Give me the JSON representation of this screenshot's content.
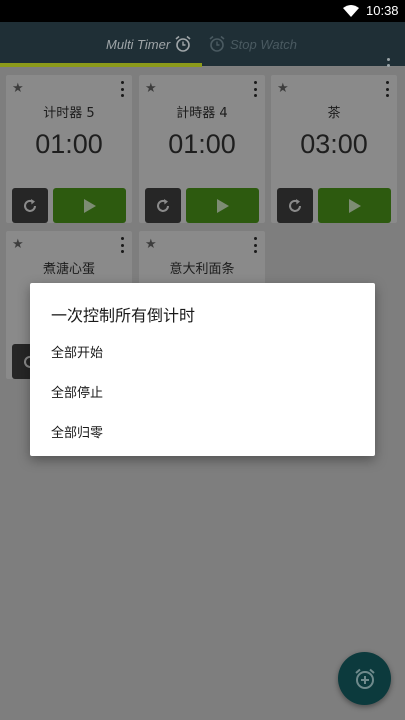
{
  "status_bar": {
    "time": "10:38"
  },
  "app_bar": {
    "tabs": [
      {
        "label": "Multi Timer",
        "active": true
      },
      {
        "label": "Stop Watch",
        "active": false
      }
    ],
    "accent_color": "#8c9a1a"
  },
  "timers": [
    {
      "name": "计时器 5",
      "time": "01:00"
    },
    {
      "name": "計時器 4",
      "time": "01:00"
    },
    {
      "name": "茶",
      "time": "03:00"
    },
    {
      "name": "煮溏心蛋",
      "time": ""
    },
    {
      "name": "意大利面条",
      "time": ""
    }
  ],
  "dialog": {
    "title": "一次控制所有倒计时",
    "options": [
      "全部开始",
      "全部停止",
      "全部归零"
    ]
  },
  "icons": {
    "wifi": "wifi-icon",
    "alarm": "alarm-clock-icon",
    "star": "star-icon",
    "reset": "reset-icon",
    "play": "play-icon",
    "more": "more-vert-icon",
    "add_alarm": "add-alarm-icon"
  }
}
